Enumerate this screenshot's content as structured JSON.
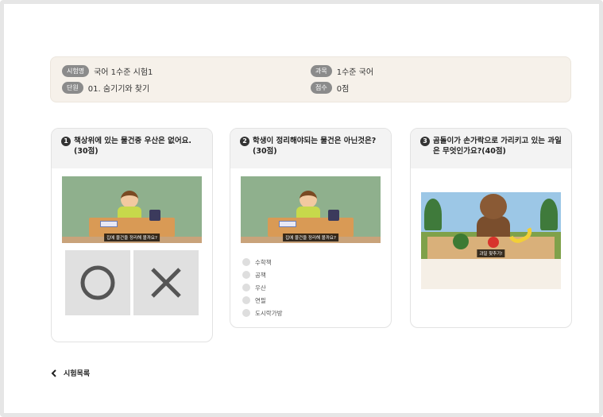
{
  "info": {
    "exam_name_label": "시험명",
    "exam_name_value": "국어 1수준 시험1",
    "subject_label": "과목",
    "subject_value": "1수준 국어",
    "unit_label": "단원",
    "unit_value": "01. 숨기기와 찾기",
    "score_label": "점수",
    "score_value": "0점"
  },
  "questions": [
    {
      "number": "1",
      "title": "책상위에 있는 물건중 우산은 없어요.(30점)",
      "video_caption": "집에 물건을 정리해 볼까요?",
      "answer_type": "ox",
      "answers": [
        {
          "symbol": "circle-icon"
        },
        {
          "symbol": "x-icon"
        }
      ]
    },
    {
      "number": "2",
      "title": "학생이 정리해야되는 물건은 아닌것은?(30점)",
      "video_caption": "집에 물건을 정리해 볼까요?",
      "answer_type": "radio",
      "options": [
        "수학책",
        "공책",
        "우산",
        "연필",
        "도시락가방"
      ]
    },
    {
      "number": "3",
      "title": "곰돌이가 손가락으로 가리키고 있는 과일은 무엇인가요?(40점)",
      "video_caption": "과일 찾추기!"
    }
  ],
  "back_link": {
    "icon": "chevron-left-icon",
    "label": "시험목록"
  }
}
